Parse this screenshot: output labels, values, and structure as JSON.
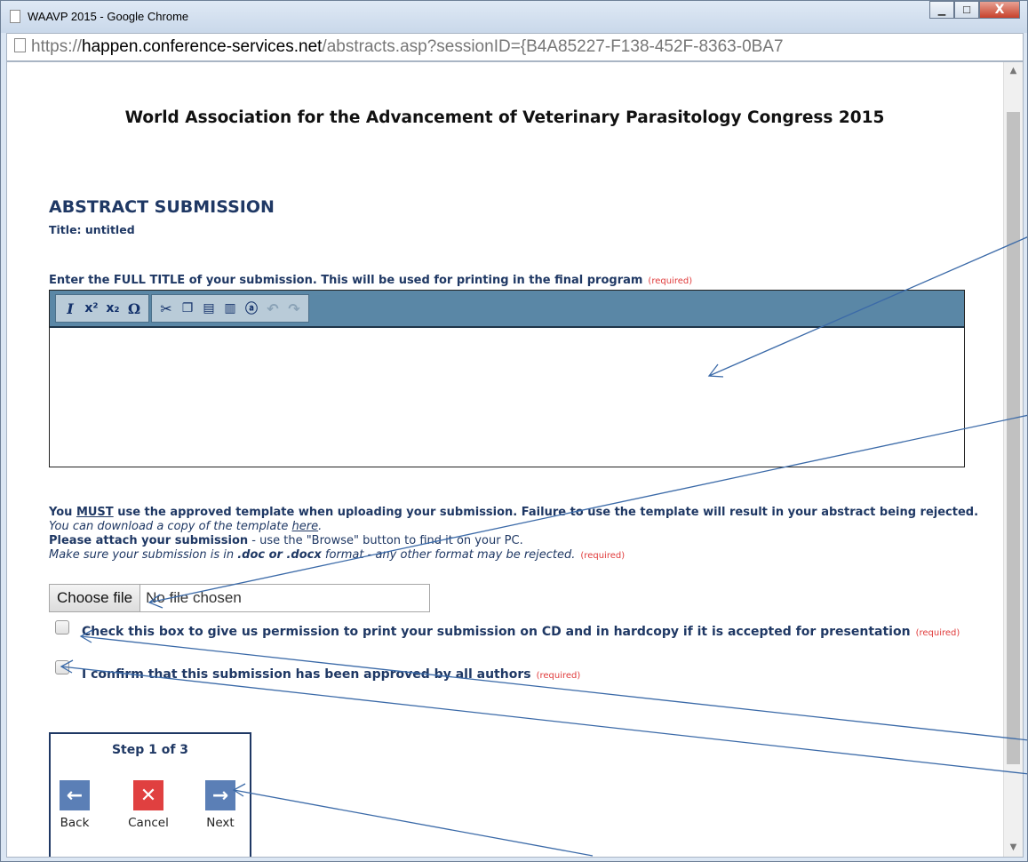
{
  "window": {
    "title": "WAAVP 2015 - Google Chrome",
    "controls": {
      "minimize": "▁",
      "maximize": "☐",
      "close": "X"
    }
  },
  "address_bar": {
    "scheme": "https://",
    "host": "happen.conference-services.net",
    "path": "/abstracts.asp?sessionID={B4A85227-F138-452F-8363-0BA7"
  },
  "page": {
    "title": "World Association for the Advancement of Veterinary Parasitology Congress 2015",
    "section_heading": "ABSTRACT SUBMISSION",
    "submission_title": "Title: untitled"
  },
  "title_field": {
    "prompt": "Enter the FULL TITLE of your submission. This will be used for printing in the final program",
    "required": "(required)",
    "toolbar": [
      "italic-icon",
      "superscript-icon",
      "subscript-icon",
      "special-char-icon",
      "cut-icon",
      "copy-icon",
      "paste-text-icon",
      "paste-word-icon",
      "select-all-icon",
      "undo-icon",
      "redo-icon"
    ]
  },
  "upload": {
    "line1_pre": "You ",
    "line1_must": "MUST",
    "line1_post": " use the approved template when uploading your submission.  Failure to use the template will result in your abstract being rejected.",
    "download_text": "You can download a copy of the template ",
    "download_link": "here",
    "attach_bold": "Please attach your submission",
    "attach_rest": " - use the \"Browse\" button to find it on your PC.",
    "format_pre": "Make sure your submission is in ",
    "format_bold": ".doc or .docx",
    "format_post": " format - any other format may be rejected.",
    "required": "(required)",
    "choose_label": "Choose file",
    "file_status": "No file chosen"
  },
  "checkboxes": [
    {
      "label": "Check this box to give us permission to print your submission on CD and in hardcopy if it is accepted for presentation",
      "required": "(required)",
      "checked": false
    },
    {
      "label": "I confirm that this submission has been approved by all authors",
      "required": "(required)",
      "checked": false
    }
  ],
  "navigation": {
    "step": "Step 1 of 3",
    "back": "Back",
    "cancel": "Cancel",
    "next": "Next"
  },
  "colors": {
    "accent": "#1f3864",
    "toolbar": "#5a87a6",
    "required": "#e03b3b",
    "cancel": "#e04040",
    "nav": "#5b7fb6",
    "annotation": "#3b6aa8"
  }
}
